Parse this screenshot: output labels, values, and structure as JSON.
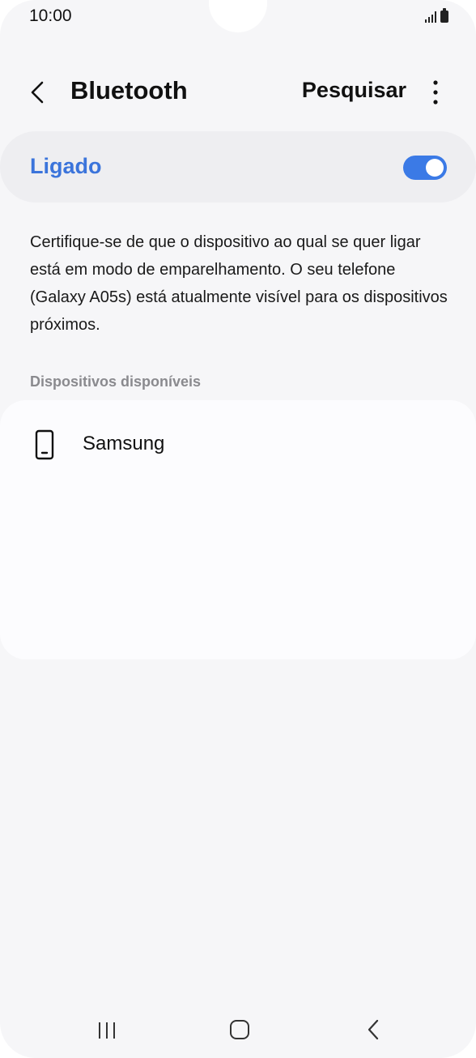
{
  "status_bar": {
    "time": "10:00"
  },
  "header": {
    "title": "Bluetooth",
    "search_label": "Pesquisar"
  },
  "bluetooth_toggle": {
    "label": "Ligado",
    "state": "on",
    "accent": "#3b7ae6"
  },
  "description": "Certifique-se de que o dispositivo ao qual se quer ligar está em modo de emparelhamento. O seu telefone (Galaxy A05s) está atualmente visível para os dispositivos próximos.",
  "available_devices": {
    "section_title": "Dispositivos disponíveis",
    "items": [
      {
        "name": "Samsung",
        "icon": "smartphone-icon"
      }
    ]
  }
}
